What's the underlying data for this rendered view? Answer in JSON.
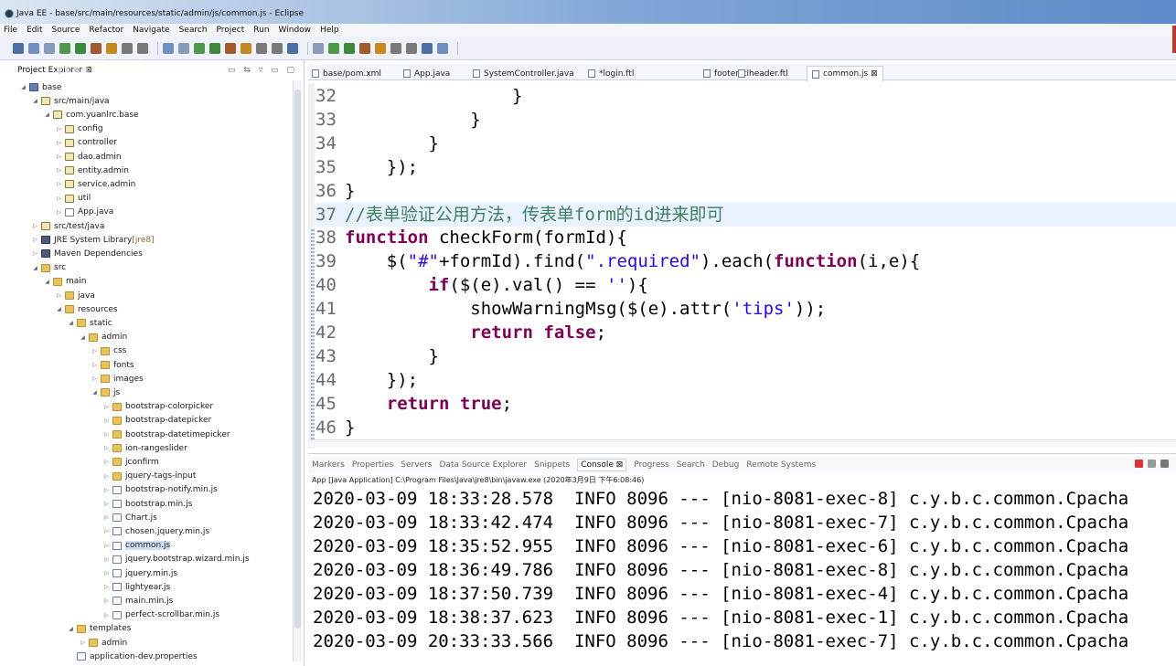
{
  "window": {
    "title": "Java EE - base/src/main/resources/static/admin/js/common.js - Eclipse"
  },
  "menu": [
    "File",
    "Edit",
    "Source",
    "Refactor",
    "Navigate",
    "Search",
    "Project",
    "Run",
    "Window",
    "Help"
  ],
  "toolbar_icons": [
    "new-icon",
    "save-icon",
    "print-icon",
    "debug-icon",
    "run-icon",
    "external-tools-icon",
    "search-icon",
    "back-icon",
    "forward-icon"
  ],
  "project_explorer": {
    "title": "Project Explorer ⊠",
    "tree": [
      {
        "label": "base",
        "indent": 0,
        "expanded": true,
        "icon": "project"
      },
      {
        "label": "src/main/java",
        "indent": 1,
        "expanded": true,
        "icon": "pkg"
      },
      {
        "label": "com.yuanlrc.base",
        "indent": 2,
        "expanded": true,
        "icon": "pkg"
      },
      {
        "label": "config",
        "indent": 3,
        "expanded": false,
        "icon": "pkg"
      },
      {
        "label": "controller",
        "indent": 3,
        "expanded": false,
        "icon": "pkg"
      },
      {
        "label": "dao.admin",
        "indent": 3,
        "expanded": false,
        "icon": "pkg"
      },
      {
        "label": "entity.admin",
        "indent": 3,
        "expanded": false,
        "icon": "pkg"
      },
      {
        "label": "service.admin",
        "indent": 3,
        "expanded": false,
        "icon": "pkg"
      },
      {
        "label": "util",
        "indent": 3,
        "expanded": false,
        "icon": "pkg"
      },
      {
        "label": "App.java",
        "indent": 3,
        "expanded": false,
        "icon": "file"
      },
      {
        "label": "src/test/java",
        "indent": 1,
        "expanded": false,
        "icon": "pkg"
      },
      {
        "label": "JRE System Library",
        "sub": "[jre8]",
        "indent": 1,
        "expanded": false,
        "icon": "lib"
      },
      {
        "label": "Maven Dependencies",
        "indent": 1,
        "expanded": false,
        "icon": "lib"
      },
      {
        "label": "src",
        "indent": 1,
        "expanded": true,
        "icon": "folder"
      },
      {
        "label": "main",
        "indent": 2,
        "expanded": true,
        "icon": "folder"
      },
      {
        "label": "java",
        "indent": 3,
        "expanded": false,
        "icon": "folder"
      },
      {
        "label": "resources",
        "indent": 3,
        "expanded": true,
        "icon": "folder"
      },
      {
        "label": "static",
        "indent": 4,
        "expanded": true,
        "icon": "folder"
      },
      {
        "label": "admin",
        "indent": 5,
        "expanded": true,
        "icon": "folder"
      },
      {
        "label": "css",
        "indent": 6,
        "expanded": false,
        "icon": "folder"
      },
      {
        "label": "fonts",
        "indent": 6,
        "expanded": false,
        "icon": "folder"
      },
      {
        "label": "images",
        "indent": 6,
        "expanded": false,
        "icon": "folder"
      },
      {
        "label": "js",
        "indent": 6,
        "expanded": true,
        "icon": "folder"
      },
      {
        "label": "bootstrap-colorpicker",
        "indent": 7,
        "expanded": false,
        "icon": "folder"
      },
      {
        "label": "bootstrap-datepicker",
        "indent": 7,
        "expanded": false,
        "icon": "folder"
      },
      {
        "label": "bootstrap-datetimepicker",
        "indent": 7,
        "expanded": false,
        "icon": "folder"
      },
      {
        "label": "ion-rangeslider",
        "indent": 7,
        "expanded": false,
        "icon": "folder"
      },
      {
        "label": "jconfirm",
        "indent": 7,
        "expanded": false,
        "icon": "folder"
      },
      {
        "label": "jquery-tags-input",
        "indent": 7,
        "expanded": false,
        "icon": "folder"
      },
      {
        "label": "bootstrap-notify.min.js",
        "indent": 7,
        "expanded": false,
        "icon": "file"
      },
      {
        "label": "bootstrap.min.js",
        "indent": 7,
        "expanded": false,
        "icon": "file"
      },
      {
        "label": "Chart.js",
        "indent": 7,
        "expanded": false,
        "icon": "file"
      },
      {
        "label": "chosen.jquery.min.js",
        "indent": 7,
        "expanded": false,
        "icon": "file"
      },
      {
        "label": "common.js",
        "indent": 7,
        "expanded": false,
        "icon": "file",
        "selected": true
      },
      {
        "label": "jquery.bootstrap.wizard.min.js",
        "indent": 7,
        "expanded": false,
        "icon": "file"
      },
      {
        "label": "jquery.min.js",
        "indent": 7,
        "expanded": false,
        "icon": "file"
      },
      {
        "label": "lightyear.js",
        "indent": 7,
        "expanded": false,
        "icon": "file"
      },
      {
        "label": "main.min.js",
        "indent": 7,
        "expanded": false,
        "icon": "file"
      },
      {
        "label": "perfect-scrollbar.min.js",
        "indent": 7,
        "expanded": false,
        "icon": "file"
      },
      {
        "label": "templates",
        "indent": 4,
        "expanded": true,
        "icon": "folder"
      },
      {
        "label": "admin",
        "indent": 5,
        "expanded": false,
        "icon": "folder"
      },
      {
        "label": "application-dev.properties",
        "indent": 4,
        "expanded": null,
        "icon": "file"
      }
    ]
  },
  "editor": {
    "tabs": [
      {
        "label": "base/pom.xml",
        "active": false
      },
      {
        "label": "App.java",
        "active": false
      },
      {
        "label": "SystemController.java",
        "active": false
      },
      {
        "label": "*login.ftl",
        "active": false
      },
      {
        "label": "footer.ftl",
        "active": false
      },
      {
        "label": "header.ftl",
        "active": false
      },
      {
        "label": "common.js ⊠",
        "active": true
      }
    ],
    "lines": [
      {
        "n": "32",
        "parts": [
          {
            "t": "                }",
            "c": ""
          }
        ]
      },
      {
        "n": "33",
        "parts": [
          {
            "t": "            }",
            "c": ""
          }
        ]
      },
      {
        "n": "34",
        "parts": [
          {
            "t": "        }",
            "c": ""
          }
        ]
      },
      {
        "n": "35",
        "parts": [
          {
            "t": "    });",
            "c": ""
          }
        ]
      },
      {
        "n": "36",
        "parts": [
          {
            "t": "}",
            "c": ""
          }
        ]
      },
      {
        "n": "37",
        "highlight": true,
        "parts": [
          {
            "t": "//表单验证公用方法，传表单form的id进来即可",
            "c": "cm"
          }
        ]
      },
      {
        "n": "38",
        "parts": [
          {
            "t": "function",
            "c": "kw"
          },
          {
            "t": " checkForm(formId){",
            "c": ""
          }
        ]
      },
      {
        "n": "39",
        "parts": [
          {
            "t": "    $(",
            "c": ""
          },
          {
            "t": "\"#\"",
            "c": "st"
          },
          {
            "t": "+formId).find(",
            "c": ""
          },
          {
            "t": "\".required\"",
            "c": "st"
          },
          {
            "t": ").each(",
            "c": ""
          },
          {
            "t": "function",
            "c": "kw"
          },
          {
            "t": "(i,e){",
            "c": ""
          }
        ]
      },
      {
        "n": "40",
        "parts": [
          {
            "t": "        ",
            "c": ""
          },
          {
            "t": "if",
            "c": "kw"
          },
          {
            "t": "($(e).val() == ",
            "c": ""
          },
          {
            "t": "''",
            "c": "st"
          },
          {
            "t": "){",
            "c": ""
          }
        ]
      },
      {
        "n": "41",
        "parts": [
          {
            "t": "            showWarningMsg($(e).attr(",
            "c": ""
          },
          {
            "t": "'tips'",
            "c": "st"
          },
          {
            "t": "));",
            "c": ""
          }
        ]
      },
      {
        "n": "42",
        "parts": [
          {
            "t": "            ",
            "c": ""
          },
          {
            "t": "return",
            "c": "kw"
          },
          {
            "t": " ",
            "c": ""
          },
          {
            "t": "false",
            "c": "kw"
          },
          {
            "t": ";",
            "c": ""
          }
        ]
      },
      {
        "n": "43",
        "parts": [
          {
            "t": "        }",
            "c": ""
          }
        ]
      },
      {
        "n": "44",
        "parts": [
          {
            "t": "    });",
            "c": ""
          }
        ]
      },
      {
        "n": "45",
        "parts": [
          {
            "t": "    ",
            "c": ""
          },
          {
            "t": "return",
            "c": "kw"
          },
          {
            "t": " ",
            "c": ""
          },
          {
            "t": "true",
            "c": "kw"
          },
          {
            "t": ";",
            "c": ""
          }
        ]
      },
      {
        "n": "46",
        "parts": [
          {
            "t": "}",
            "c": ""
          }
        ]
      }
    ]
  },
  "console": {
    "tabs": [
      {
        "label": "Markers",
        "active": false
      },
      {
        "label": "Properties",
        "active": false
      },
      {
        "label": "Servers",
        "active": false
      },
      {
        "label": "Data Source Explorer",
        "active": false
      },
      {
        "label": "Snippets",
        "active": false
      },
      {
        "label": "Console ⊠",
        "active": true
      },
      {
        "label": "Progress",
        "active": false
      },
      {
        "label": "Search",
        "active": false
      },
      {
        "label": "Debug",
        "active": false
      },
      {
        "label": "Remote Systems",
        "active": false
      }
    ],
    "path": "App [Java Application] C:\\Program Files\\Java\\jre8\\bin\\javaw.exe (2020年3月9日 下午6:08:46)",
    "lines": [
      "2020-03-09 18:33:28.578  INFO 8096 --- [nio-8081-exec-8] c.y.b.c.common.Cpacha",
      "2020-03-09 18:33:42.474  INFO 8096 --- [nio-8081-exec-7] c.y.b.c.common.Cpacha",
      "2020-03-09 18:35:52.955  INFO 8096 --- [nio-8081-exec-6] c.y.b.c.common.Cpacha",
      "2020-03-09 18:36:49.786  INFO 8096 --- [nio-8081-exec-8] c.y.b.c.common.Cpacha",
      "2020-03-09 18:37:50.739  INFO 8096 --- [nio-8081-exec-4] c.y.b.c.common.Cpacha",
      "2020-03-09 18:38:37.623  INFO 8096 --- [nio-8081-exec-1] c.y.b.c.common.Cpacha",
      "2020-03-09 20:33:33.566  INFO 8096 --- [nio-8081-exec-7] c.y.b.c.common.Cpacha"
    ]
  },
  "colors": {
    "keyword": "#7f0055",
    "string": "#2a00ff",
    "comment": "#3f7f5f",
    "selection": "#cfe0f6",
    "line_highlight": "#e8f2fe"
  }
}
